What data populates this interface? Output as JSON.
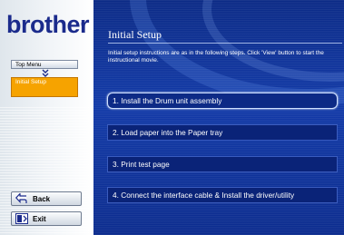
{
  "brand": {
    "logo_text": "brother",
    "logo_mark": "®"
  },
  "sidebar": {
    "top_menu_label": "Top Menu",
    "current_section_label": "Initial Setup",
    "back_label": "Back",
    "exit_label": "Exit"
  },
  "main": {
    "title": "Initial Setup",
    "intro": "Initial setup instructions are as in the following steps. Click 'View' button to start the instructional movie.",
    "steps": [
      {
        "label": "1. Install the Drum unit assembly"
      },
      {
        "label": "2. Load paper into the Paper tray"
      },
      {
        "label": "3. Print test page"
      },
      {
        "label": "4. Connect the interface cable & Install the driver/utility"
      }
    ]
  },
  "colors": {
    "brand_blue": "#1b2b8c",
    "panel_blue": "#123aa8",
    "current_section_orange": "#f6a300"
  },
  "icons": [
    "chevron-down-icon",
    "back-arrow-icon",
    "exit-icon"
  ]
}
